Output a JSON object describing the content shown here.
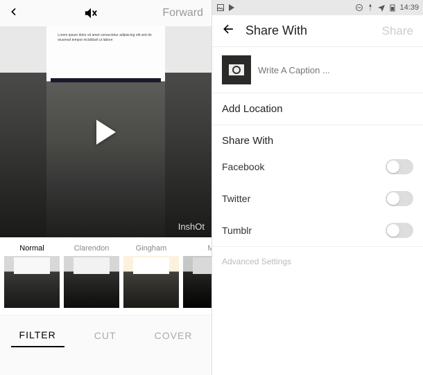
{
  "left": {
    "forward_label": "Forward",
    "watermark": "InshOt",
    "filters": [
      {
        "label": "Normal",
        "active": true
      },
      {
        "label": "Clarendon",
        "active": false
      },
      {
        "label": "Gingham",
        "active": false
      },
      {
        "label": "M",
        "active": false
      }
    ],
    "tabs": {
      "filter": "FILTER",
      "cut": "CUT",
      "cover": "COVER"
    }
  },
  "right": {
    "statusbar": {
      "time": "14:39"
    },
    "header": {
      "title": "Share With",
      "action": "Share"
    },
    "caption_placeholder": "Write A Caption ...",
    "add_location": "Add Location",
    "share_with_label": "Share With",
    "options": {
      "facebook": "Facebook",
      "twitter": "Twitter",
      "tumblr": "Tumblr"
    },
    "advanced": "Advanced Settings"
  }
}
